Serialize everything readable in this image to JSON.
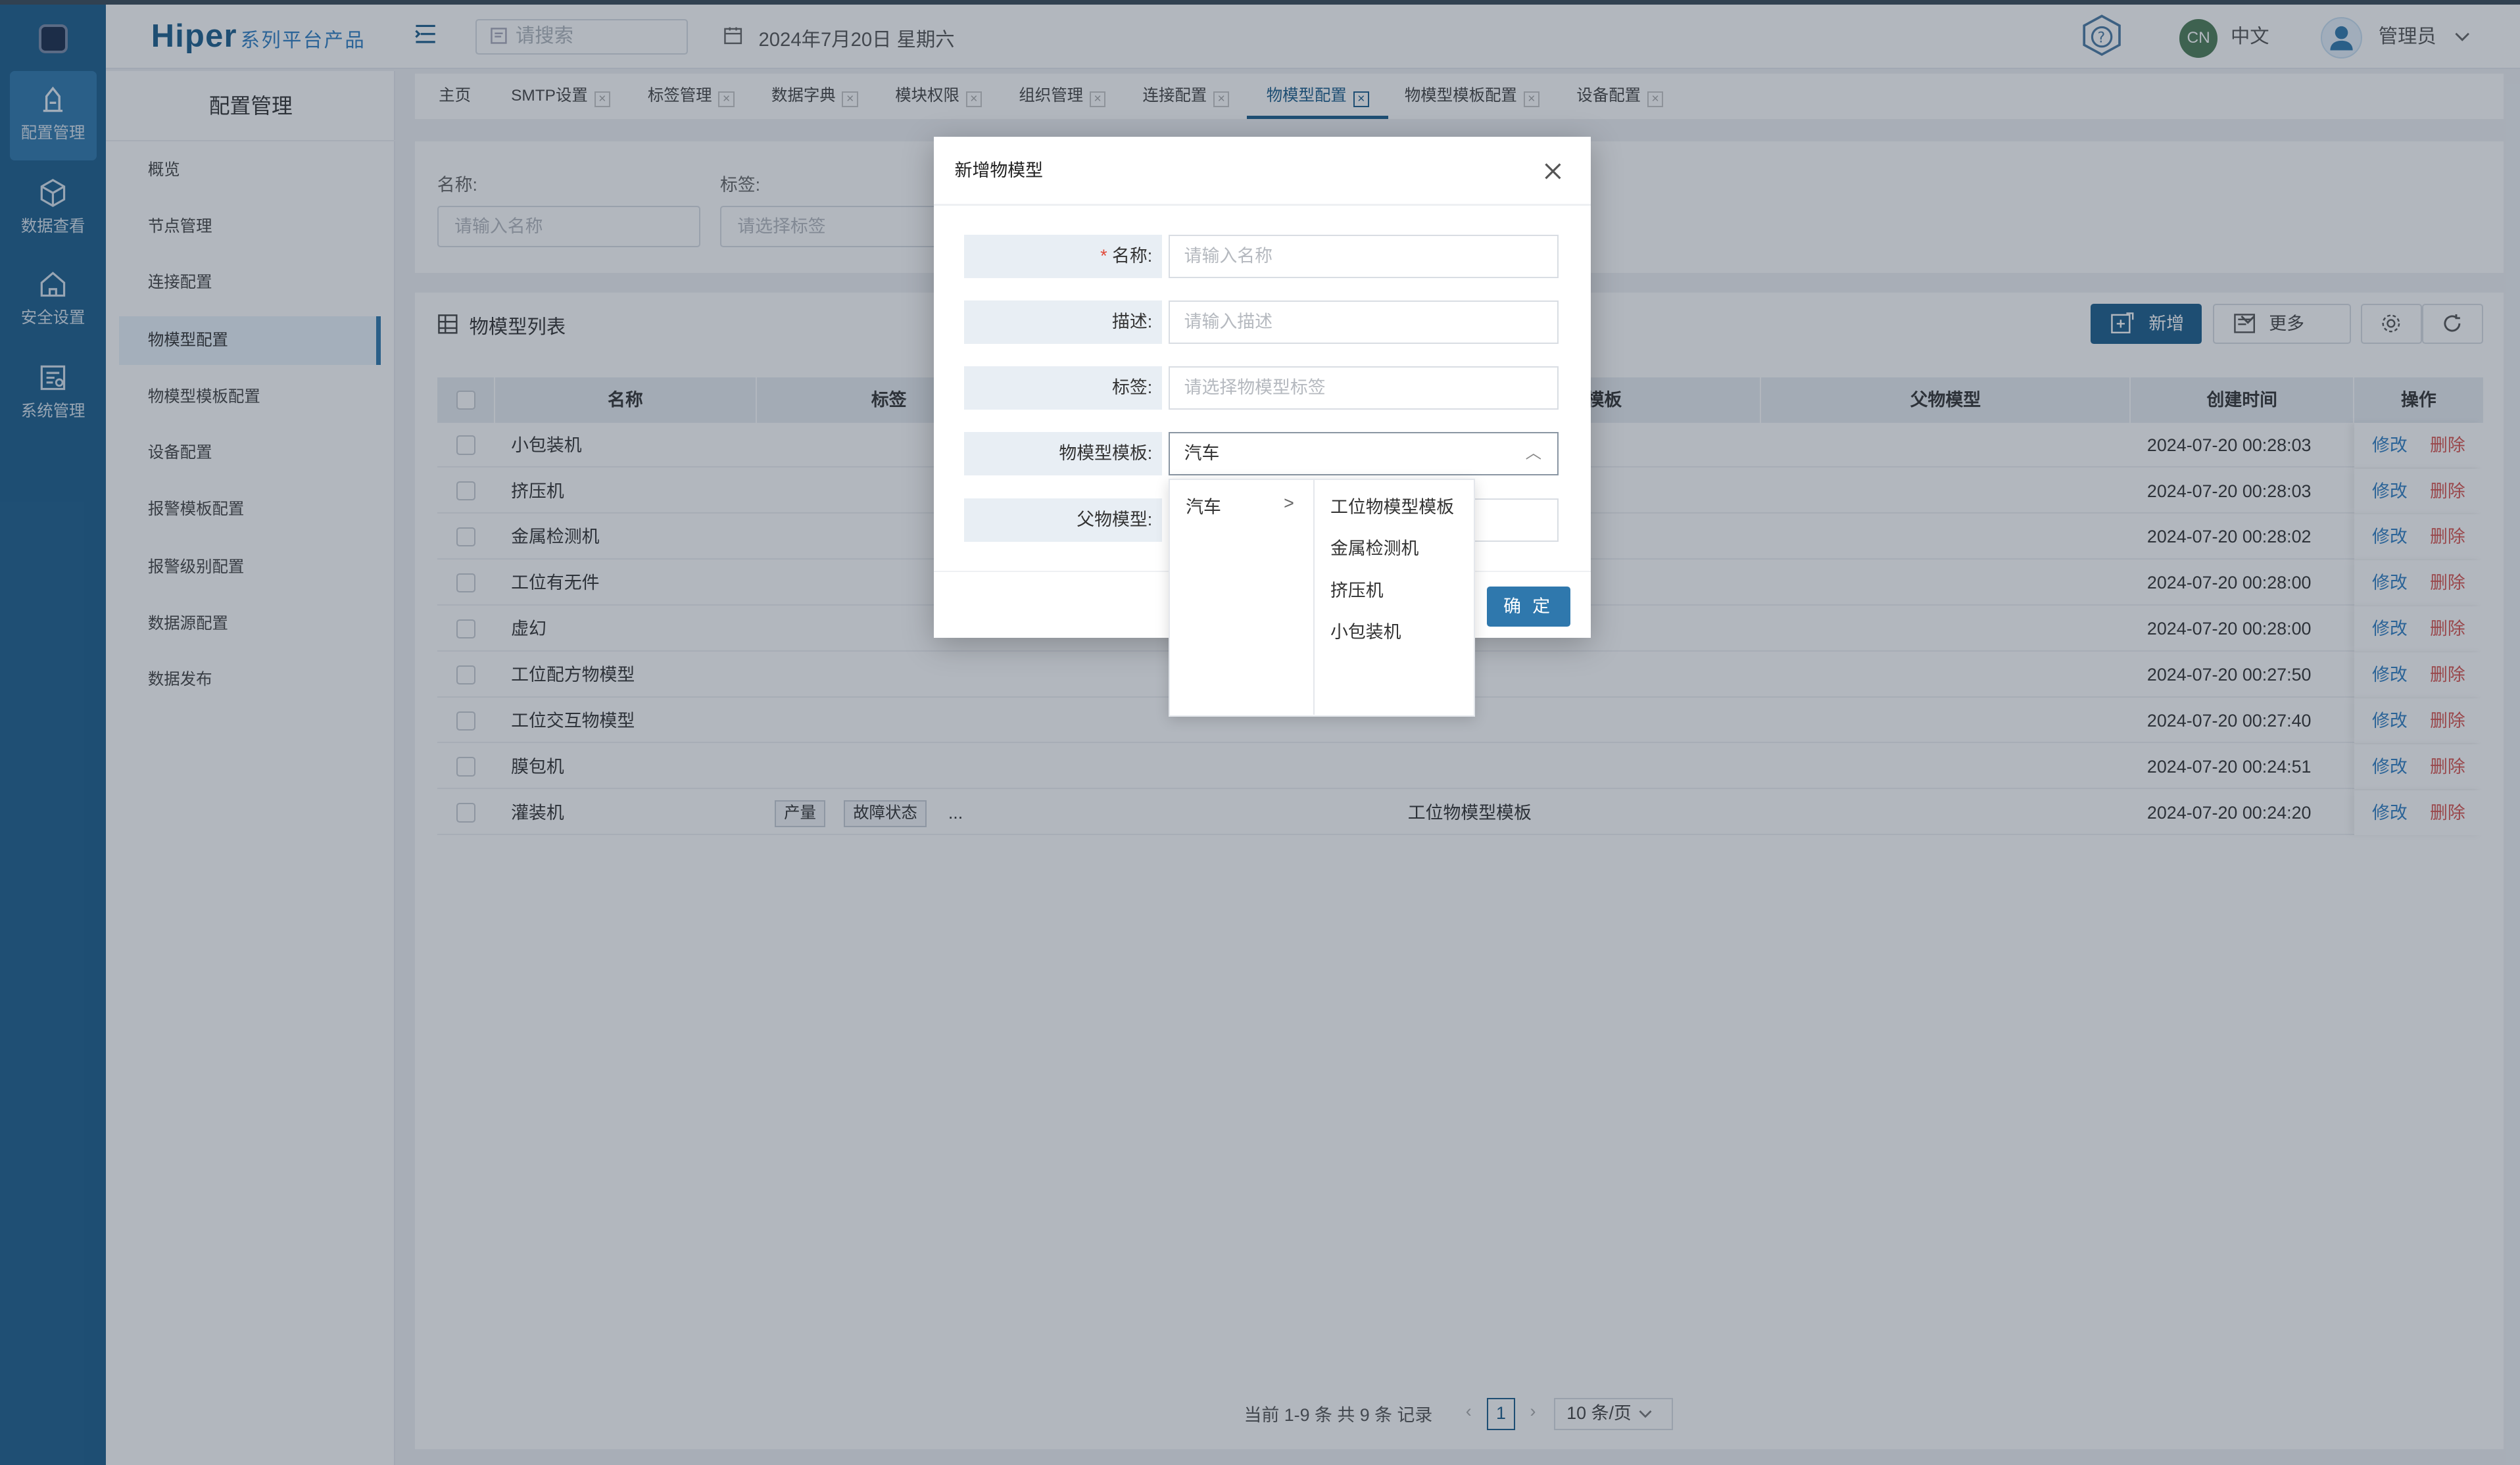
{
  "header": {
    "brand": "Hiper",
    "brand_sub": "系列平台产品",
    "search_placeholder": "请搜索",
    "date": "2024年7月20日 星期六",
    "lang_badge": "CN",
    "lang": "中文",
    "user": "管理员"
  },
  "rail": [
    {
      "label": "配置管理",
      "icon": "config-icon"
    },
    {
      "label": "数据查看",
      "icon": "cube-icon"
    },
    {
      "label": "安全设置",
      "icon": "shield-home-icon"
    },
    {
      "label": "系统管理",
      "icon": "system-icon"
    }
  ],
  "subnav": {
    "title": "配置管理",
    "items": [
      "概览",
      "节点管理",
      "连接配置",
      "物模型配置",
      "物模型模板配置",
      "设备配置",
      "报警模板配置",
      "报警级别配置",
      "数据源配置",
      "数据发布"
    ]
  },
  "tabs": [
    "主页",
    "SMTP设置",
    "标签管理",
    "数据字典",
    "模块权限",
    "组织管理",
    "连接配置",
    "物模型配置",
    "物模型模板配置",
    "设备配置"
  ],
  "filter": {
    "name_label": "名称:",
    "name_placeholder": "请输入名称",
    "tag_label": "标签:",
    "tag_placeholder": "请选择标签"
  },
  "list": {
    "title": "物模型列表",
    "add_label": "新增",
    "more_label": "更多",
    "columns": [
      "名称",
      "标签",
      "模板",
      "父物模型",
      "创建时间",
      "操作"
    ],
    "rows": [
      {
        "name": "小包装机",
        "tags": [],
        "template": "",
        "created": "2024-07-20 00:28:03"
      },
      {
        "name": "挤压机",
        "tags": [],
        "template": "",
        "created": "2024-07-20 00:28:03"
      },
      {
        "name": "金属检测机",
        "tags": [],
        "template": "",
        "created": "2024-07-20 00:28:02"
      },
      {
        "name": "工位有无件",
        "tags": [],
        "template": "",
        "created": "2024-07-20 00:28:00"
      },
      {
        "name": "虚幻",
        "tags": [],
        "template": "",
        "created": "2024-07-20 00:28:00"
      },
      {
        "name": "工位配方物模型",
        "tags": [],
        "template": "",
        "created": "2024-07-20 00:27:50"
      },
      {
        "name": "工位交互物模型",
        "tags": [],
        "template": "",
        "created": "2024-07-20 00:27:40"
      },
      {
        "name": "膜包机",
        "tags": [],
        "template": "",
        "created": "2024-07-20 00:24:51"
      },
      {
        "name": "灌装机",
        "tags": [
          "产量",
          "故障状态"
        ],
        "more": "...",
        "template": "工位物模型模板",
        "created": "2024-07-20 00:24:20"
      }
    ],
    "edit_label": "修改",
    "delete_label": "删除",
    "pager_text": "当前 1-9 条 共 9 条 记录",
    "page": "1",
    "page_size": "10 条/页"
  },
  "modal": {
    "title": "新增物模型",
    "name_label": "名称:",
    "name_placeholder": "请输入名称",
    "desc_label": "描述:",
    "desc_placeholder": "请输入描述",
    "tag_label": "标签:",
    "tag_placeholder": "请选择物模型标签",
    "template_label": "物模型模板:",
    "template_value": "汽车",
    "parent_label": "父物模型:",
    "ok_label": "确 定"
  },
  "cascade": {
    "level1": [
      "汽车"
    ],
    "level2": [
      "工位物模型模板",
      "金属检测机",
      "挤压机",
      "小包装机"
    ]
  },
  "colors": {
    "primary": "#1d5e8c",
    "rail": "#1d5e8c",
    "danger": "#d9534f",
    "link": "#2f7fc4"
  }
}
